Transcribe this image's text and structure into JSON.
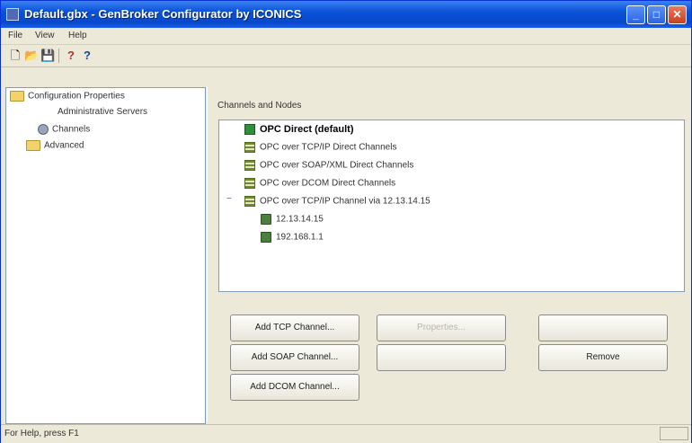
{
  "window": {
    "title": "Default.gbx - GenBroker Configurator by ICONICS"
  },
  "menu": [
    "File",
    "View",
    "Help"
  ],
  "toolbar": {
    "icons": [
      "new-file-icon",
      "open-folder-icon",
      "save-icon",
      "info-icon",
      "help-pointer-icon"
    ],
    "glyphs": [
      "🗋",
      "📂",
      "💾",
      "?",
      "?"
    ]
  },
  "sidebar": {
    "items": [
      {
        "label": "Configuration Properties",
        "icon": "folder-icon"
      },
      {
        "label": "Administrative Servers",
        "icon": ""
      },
      {
        "label": "Channels",
        "icon": "gear-icon"
      },
      {
        "label": "Advanced",
        "icon": "folder-icon"
      }
    ]
  },
  "channels": {
    "group_label": "Channels and Nodes",
    "nodes": [
      {
        "label": "OPC Direct (default)",
        "bold": true,
        "icon": "network-icon"
      },
      {
        "label": "OPC over TCP/IP Direct Channels",
        "icon": "channel-icon"
      },
      {
        "label": "OPC over SOAP/XML Direct Channels",
        "icon": "channel-icon"
      },
      {
        "label": "OPC over DCOM Direct Channels",
        "icon": "channel-icon"
      },
      {
        "label": "OPC over TCP/IP Channel via 12.13.14.15",
        "icon": "channel-icon"
      },
      {
        "label": "12.13.14.15",
        "icon": "computer-icon"
      },
      {
        "label": "192.168.1.1",
        "icon": "computer-icon"
      }
    ],
    "expander": "−"
  },
  "buttons": {
    "add_tcp": "Add TCP Channel...",
    "add_soap": "Add SOAP Channel...",
    "add_dcom": "Add DCOM Channel...",
    "properties": "Properties...",
    "remove": "Remove"
  },
  "status": {
    "text": "For Help, press F1"
  },
  "colors": {
    "title_bar": "#0a52d8",
    "window_bg": "#ece9d8",
    "list_border": "#7f9db9"
  }
}
